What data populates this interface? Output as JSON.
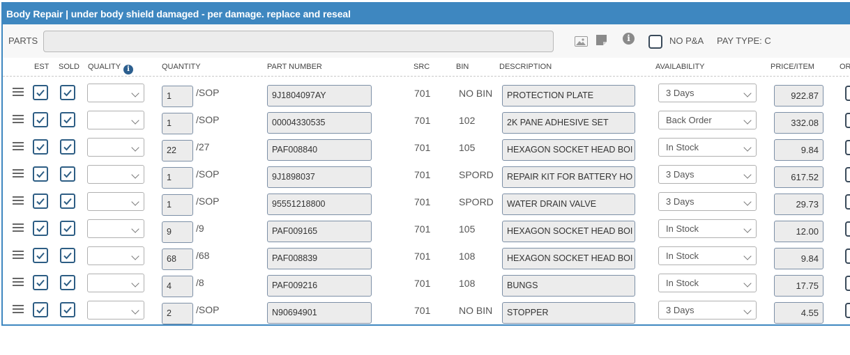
{
  "panel": {
    "title": "Body Repair | under body shield damaged - per damage. replace and reseal"
  },
  "parts_bar": {
    "label": "PARTS",
    "input_value": "",
    "no_pa_label": "NO P&A",
    "pay_type_label": "PAY TYPE: C"
  },
  "columns": {
    "est": "EST",
    "sold": "SOLD",
    "quality": "QUALITY",
    "quantity": "QUANTITY",
    "part_number": "PART NUMBER",
    "src": "SRC",
    "bin": "BIN",
    "description": "DESCRIPTION",
    "availability": "AVAILABILITY",
    "price_item": "PRICE/ITEM",
    "order": "OR"
  },
  "rows": [
    {
      "est": true,
      "sold": true,
      "quality": "",
      "qty": "1",
      "qty_suffix": "/SOP",
      "part_number": "9J1804097AY",
      "src": "701",
      "bin": "NO BIN",
      "description": "PROTECTION PLATE",
      "availability": "3 Days",
      "price": "922.87"
    },
    {
      "est": true,
      "sold": true,
      "quality": "",
      "qty": "1",
      "qty_suffix": "/SOP",
      "part_number": "00004330535",
      "src": "701",
      "bin": "102",
      "description": "2K PANE ADHESIVE SET",
      "availability": "Back Order",
      "price": "332.08"
    },
    {
      "est": true,
      "sold": true,
      "quality": "",
      "qty": "22",
      "qty_suffix": "/27",
      "part_number": "PAF008840",
      "src": "701",
      "bin": "105",
      "description": "HEXAGON SOCKET HEAD BOI",
      "availability": "In Stock",
      "price": "9.84"
    },
    {
      "est": true,
      "sold": true,
      "quality": "",
      "qty": "1",
      "qty_suffix": "/SOP",
      "part_number": "9J1898037",
      "src": "701",
      "bin": "SPORD",
      "description": "REPAIR KIT FOR BATTERY HO",
      "availability": "3 Days",
      "price": "617.52"
    },
    {
      "est": true,
      "sold": true,
      "quality": "",
      "qty": "1",
      "qty_suffix": "/SOP",
      "part_number": "95551218800",
      "src": "701",
      "bin": "SPORD",
      "description": "WATER DRAIN VALVE",
      "availability": "3 Days",
      "price": "29.73"
    },
    {
      "est": true,
      "sold": true,
      "quality": "",
      "qty": "9",
      "qty_suffix": "/9",
      "part_number": "PAF009165",
      "src": "701",
      "bin": "105",
      "description": "HEXAGON SOCKET HEAD BOI",
      "availability": "In Stock",
      "price": "12.00"
    },
    {
      "est": true,
      "sold": true,
      "quality": "",
      "qty": "68",
      "qty_suffix": "/68",
      "part_number": "PAF008839",
      "src": "701",
      "bin": "108",
      "description": "HEXAGON SOCKET HEAD BOI",
      "availability": "In Stock",
      "price": "9.84"
    },
    {
      "est": true,
      "sold": true,
      "quality": "",
      "qty": "4",
      "qty_suffix": "/8",
      "part_number": "PAF009216",
      "src": "701",
      "bin": "108",
      "description": "BUNGS",
      "availability": "In Stock",
      "price": "17.75"
    },
    {
      "est": true,
      "sold": true,
      "quality": "",
      "qty": "2",
      "qty_suffix": "/SOP",
      "part_number": "N90694901",
      "src": "701",
      "bin": "NO BIN",
      "description": "STOPPER",
      "availability": "3 Days",
      "price": "4.55"
    }
  ],
  "colors": {
    "accent": "#3e87c0",
    "checkbox_border": "#2d5d84",
    "field_bg": "#ececec"
  }
}
